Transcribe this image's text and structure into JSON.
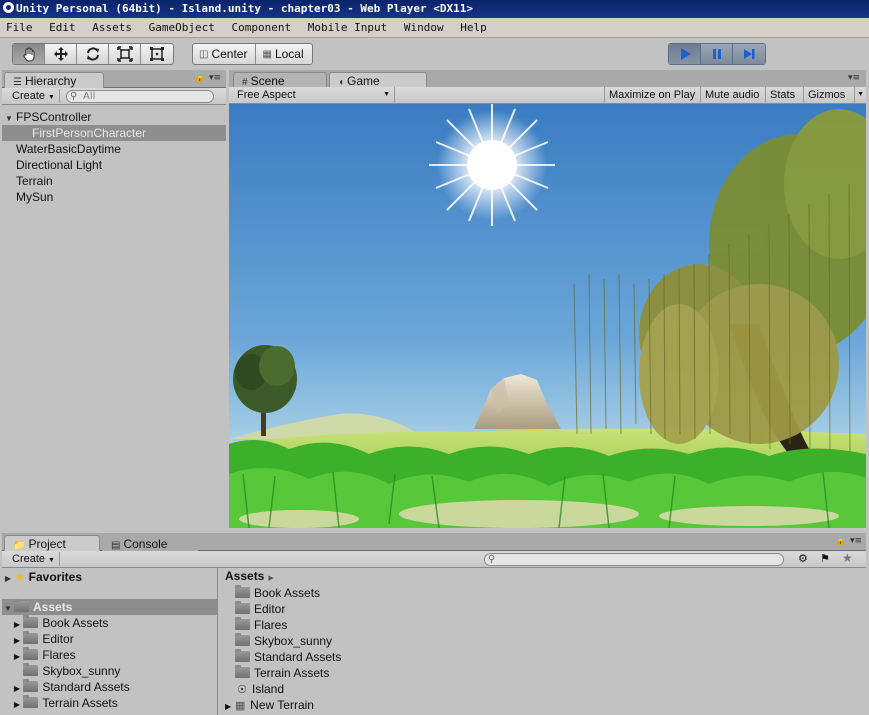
{
  "window": {
    "title": "Unity Personal (64bit) - Island.unity - chapter03 - Web Player <DX11>"
  },
  "menu": [
    "File",
    "Edit",
    "Assets",
    "GameObject",
    "Component",
    "Mobile Input",
    "Window",
    "Help"
  ],
  "toolbar": {
    "tools": [
      "hand-icon",
      "move-icon",
      "rotate-icon",
      "scale-icon",
      "rect-icon"
    ],
    "pivot_mode": "Center",
    "pivot_rotation": "Local",
    "play_state": "playing"
  },
  "hierarchy": {
    "tab": "Hierarchy",
    "create": "Create",
    "search_placeholder": "All",
    "items": [
      {
        "label": "FPSController",
        "depth": 0,
        "expanded": true
      },
      {
        "label": "FirstPersonCharacter",
        "depth": 1,
        "selected": true
      },
      {
        "label": "WaterBasicDaytime",
        "depth": 0
      },
      {
        "label": "Directional Light",
        "depth": 0
      },
      {
        "label": "Terrain",
        "depth": 0
      },
      {
        "label": "MySun",
        "depth": 0
      }
    ]
  },
  "view_tabs": {
    "scene": "Scene",
    "game": "Game"
  },
  "game_toolbar": {
    "aspect": "Free Aspect",
    "maximize": "Maximize on Play",
    "mute": "Mute audio",
    "stats": "Stats",
    "gizmos": "Gizmos"
  },
  "bottom_tabs": {
    "project": "Project",
    "console": "Console"
  },
  "project": {
    "create": "Create",
    "favorites": "Favorites",
    "assets_root": "Assets",
    "tree": [
      {
        "label": "Book Assets",
        "has_children": true
      },
      {
        "label": "Editor",
        "has_children": true
      },
      {
        "label": "Flares",
        "has_children": true
      },
      {
        "label": "Skybox_sunny",
        "has_children": false
      },
      {
        "label": "Standard Assets",
        "has_children": true
      },
      {
        "label": "Terrain Assets",
        "has_children": true
      }
    ],
    "breadcrumb": "Assets",
    "contents": [
      {
        "label": "Book Assets",
        "kind": "folder"
      },
      {
        "label": "Editor",
        "kind": "folder"
      },
      {
        "label": "Flares",
        "kind": "folder"
      },
      {
        "label": "Skybox_sunny",
        "kind": "folder"
      },
      {
        "label": "Standard Assets",
        "kind": "folder"
      },
      {
        "label": "Terrain Assets",
        "kind": "folder"
      },
      {
        "label": "Island",
        "kind": "scene"
      },
      {
        "label": "New Terrain",
        "kind": "terrain"
      }
    ]
  }
}
